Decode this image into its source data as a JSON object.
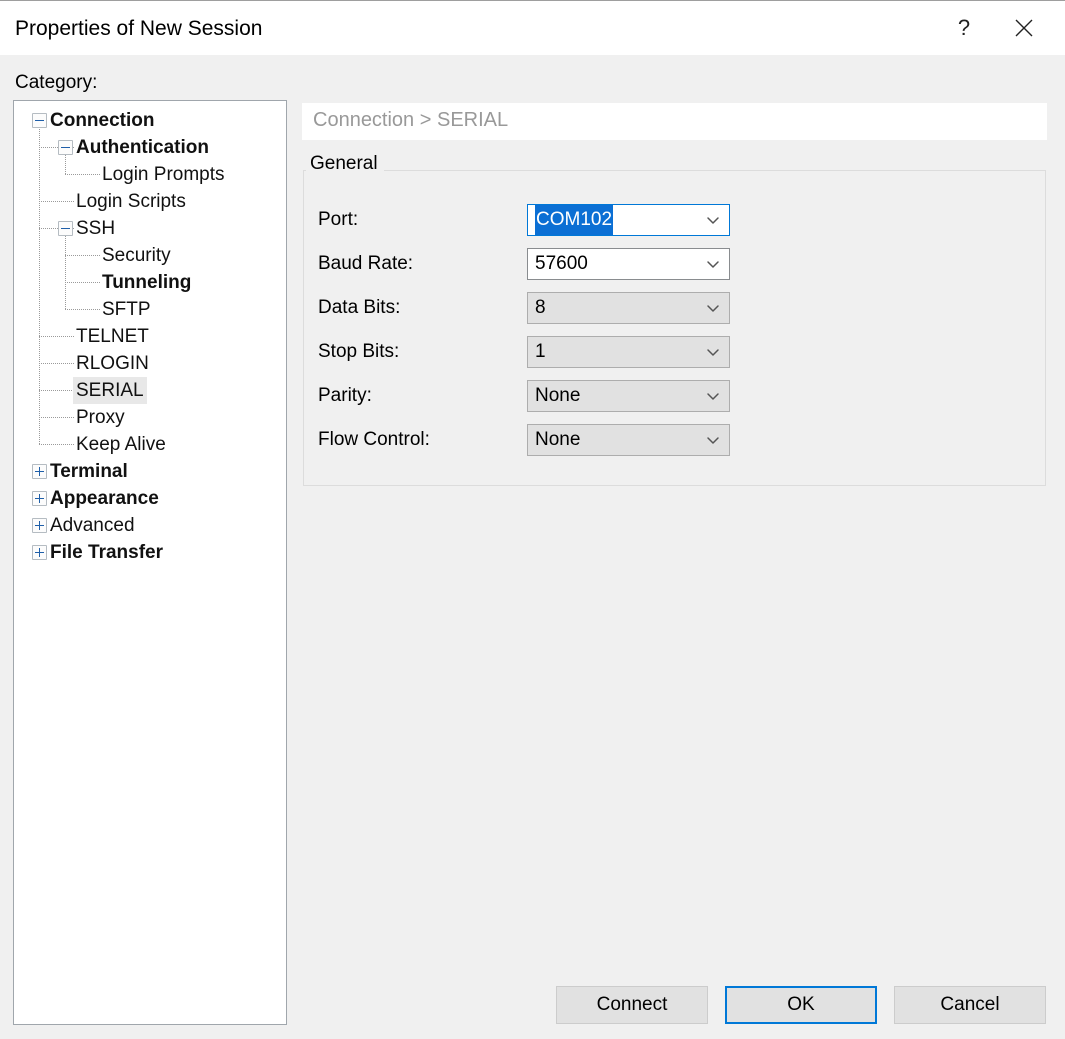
{
  "window": {
    "title": "Properties of New Session",
    "help_icon": "question-mark-icon",
    "help_glyph": "?",
    "close_icon": "close-icon"
  },
  "sidebar": {
    "label": "Category:",
    "items": [
      {
        "label": "Connection",
        "level": 0,
        "expander": "minus",
        "bold": true,
        "selected": false
      },
      {
        "label": "Authentication",
        "level": 1,
        "expander": "minus",
        "bold": true,
        "selected": false
      },
      {
        "label": "Login Prompts",
        "level": 2,
        "expander": "none",
        "bold": false,
        "selected": false
      },
      {
        "label": "Login Scripts",
        "level": 1,
        "expander": "none",
        "bold": false,
        "selected": false
      },
      {
        "label": "SSH",
        "level": 1,
        "expander": "minus",
        "bold": false,
        "selected": false
      },
      {
        "label": "Security",
        "level": 2,
        "expander": "none",
        "bold": false,
        "selected": false
      },
      {
        "label": "Tunneling",
        "level": 2,
        "expander": "none",
        "bold": true,
        "selected": false
      },
      {
        "label": "SFTP",
        "level": 2,
        "expander": "none",
        "bold": false,
        "selected": false
      },
      {
        "label": "TELNET",
        "level": 1,
        "expander": "none",
        "bold": false,
        "selected": false
      },
      {
        "label": "RLOGIN",
        "level": 1,
        "expander": "none",
        "bold": false,
        "selected": false
      },
      {
        "label": "SERIAL",
        "level": 1,
        "expander": "none",
        "bold": false,
        "selected": true
      },
      {
        "label": "Proxy",
        "level": 1,
        "expander": "none",
        "bold": false,
        "selected": false
      },
      {
        "label": "Keep Alive",
        "level": 1,
        "expander": "none",
        "bold": false,
        "selected": false
      },
      {
        "label": "Terminal",
        "level": 0,
        "expander": "plus",
        "bold": true,
        "selected": false
      },
      {
        "label": "Appearance",
        "level": 0,
        "expander": "plus",
        "bold": true,
        "selected": false
      },
      {
        "label": "Advanced",
        "level": 0,
        "expander": "plus",
        "bold": false,
        "selected": false
      },
      {
        "label": "File Transfer",
        "level": 0,
        "expander": "plus",
        "bold": true,
        "selected": false
      }
    ]
  },
  "main": {
    "breadcrumb": "Connection > SERIAL",
    "group_title": "General",
    "fields": [
      {
        "label": "Port:",
        "value": "COM102",
        "style": "editable",
        "focused": true,
        "text_selected": true
      },
      {
        "label": "Baud Rate:",
        "value": "57600",
        "style": "editable",
        "focused": false,
        "text_selected": false
      },
      {
        "label": "Data Bits:",
        "value": "8",
        "style": "dropdown",
        "focused": false,
        "text_selected": false
      },
      {
        "label": "Stop Bits:",
        "value": "1",
        "style": "dropdown",
        "focused": false,
        "text_selected": false
      },
      {
        "label": "Parity:",
        "value": "None",
        "style": "dropdown",
        "focused": false,
        "text_selected": false
      },
      {
        "label": "Flow Control:",
        "value": "None",
        "style": "dropdown",
        "focused": false,
        "text_selected": false
      }
    ]
  },
  "footer": {
    "connect_label": "Connect",
    "ok_label": "OK",
    "cancel_label": "Cancel"
  },
  "colors": {
    "accent": "#0078d7",
    "selection": "#0b6fd4",
    "body_bg": "#f0f0f0",
    "field_disabled_bg": "#e1e1e1"
  }
}
